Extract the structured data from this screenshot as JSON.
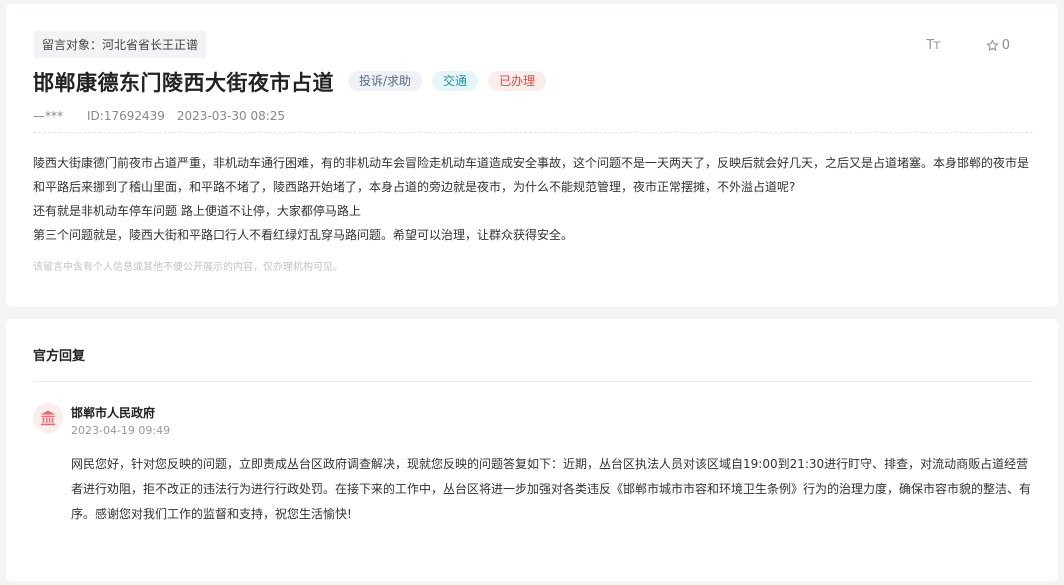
{
  "message": {
    "target_label": "留言对象：河北省省长王正谱",
    "title": "邯郸康德东门陵西大街夜市占道",
    "tags": [
      "投诉/求助",
      "交通",
      "已办理"
    ],
    "author": "—***",
    "id_text": "ID:17692439",
    "datetime": "2023-03-30 08:25",
    "font_size_tool": "Tт",
    "favorite_count": "0",
    "paragraphs": [
      "陵西大街康德门前夜市占道严重，非机动车通行困难，有的非机动车会冒险走机动车道造成安全事故，这个问题不是一天两天了，反映后就会好几天，之后又是占道堵塞。本身邯郸的夜市是和平路后来挪到了稽山里面，和平路不堵了，陵西路开始堵了，本身占道的旁边就是夜市，为什么不能规范管理，夜市正常摆摊，不外溢占道呢?",
      "还有就是非机动车停车问题 路上便道不让停，大家都停马路上",
      "第三个问题就是，陵西大街和平路口行人不看红绿灯乱穿马路问题。希望可以治理，让群众获得安全。"
    ],
    "privacy_notice": "该留言中含有个人信息或其他不便公开展示的内容，仅办理机构可见。"
  },
  "reply": {
    "heading": "官方回复",
    "org_name": "邯郸市人民政府",
    "datetime": "2023-04-19 09:49",
    "text": "网民您好，针对您反映的问题，立即责成丛台区政府调查解决，现就您反映的问题答复如下：近期，丛台区执法人员对该区域自19:00到21:30进行盯守、排查，对流动商贩占道经营者进行劝阻，拒不改正的违法行为进行行政处罚。在接下来的工作中，丛台区将进一步加强对各类违反《邯郸市城市市容和环境卫生条例》行为的治理力度，确保市容市貌的整洁、有序。感谢您对我们工作的监督和支持，祝您生活愉快!"
  },
  "colors": {
    "tag_gray": "#5c6b80",
    "tag_cyan": "#2a8fa8",
    "tag_red": "#e24a4a",
    "avatar_icon": "#e46a6a"
  },
  "icons": [
    "font-size-icon",
    "star-icon",
    "government-building-icon"
  ]
}
